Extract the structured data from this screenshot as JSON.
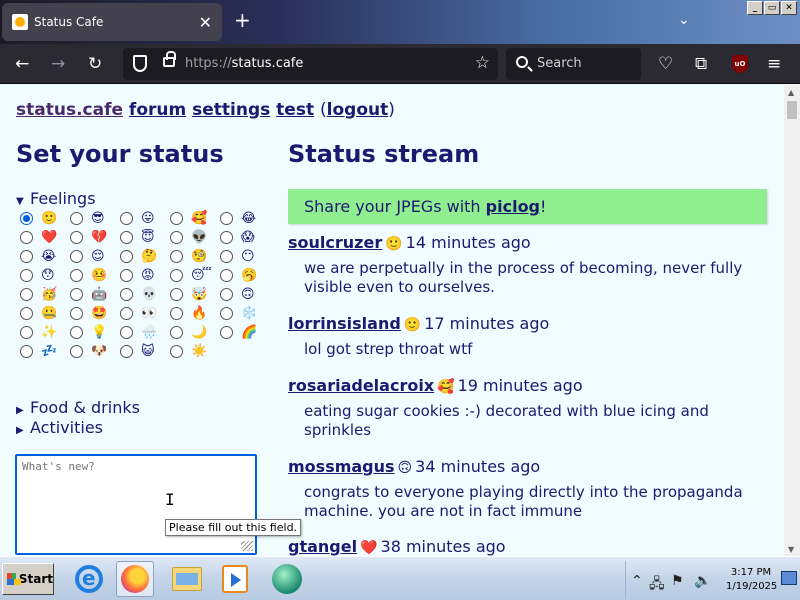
{
  "browser": {
    "tab_title": "Status Cafe",
    "new_tab": "+",
    "url_scheme": "https://",
    "url_host": "status.cafe",
    "search_placeholder": "Search",
    "window_buttons": [
      "_",
      "▭",
      "✕"
    ],
    "ublock_label": "uO"
  },
  "nav": {
    "brand": "status.cafe",
    "links": [
      "forum",
      "settings",
      "test"
    ],
    "logout": "logout"
  },
  "left": {
    "heading": "Set your status",
    "feelings_label": "Feelings",
    "emojis": [
      "🙂",
      "😎",
      "😛",
      "🥰",
      "😂",
      "❤️",
      "💔",
      "😇",
      "👽",
      "😱",
      "😭",
      "😌",
      "🤔",
      "🧐",
      "😶",
      "😯",
      "🤒",
      "😡",
      "😴",
      "🥱",
      "🥳",
      "🤖",
      "💀",
      "🤯",
      "🙃",
      "🤐",
      "🤩",
      "👀",
      "🔥",
      "❄️",
      "✨",
      "💡",
      "🌧️",
      "🌙",
      "🌈",
      "💤",
      "🐶",
      "😺",
      "☀️"
    ],
    "selected_index": 0,
    "food_label": "Food & drinks",
    "activities_label": "Activities",
    "input_placeholder": "What's new?",
    "tooltip": "Please fill out this field."
  },
  "stream": {
    "heading": "Status stream",
    "banner_prefix": "Share your JPEGs with ",
    "banner_link": "piclog",
    "banner_suffix": "!",
    "entries": [
      {
        "user": "soulcruzer",
        "face": "🙂",
        "time": "14 minutes ago",
        "text": "we are perpetually in the process of becoming, never fully visible even to ourselves."
      },
      {
        "user": "lorrinsisland",
        "face": "🙂",
        "time": "17 minutes ago",
        "text": "lol got strep throat wtf"
      },
      {
        "user": "rosariadelacroix",
        "face": "🥰",
        "time": "19 minutes ago",
        "text": "eating sugar cookies :-) decorated with blue icing and sprinkles"
      },
      {
        "user": "mossmagus",
        "face": "🙃",
        "time": "34 minutes ago",
        "text": "congrats to everyone playing directly into the propaganda machine. you are not in fact immune"
      },
      {
        "user": "gtangel",
        "face": "❤️",
        "time": "38 minutes ago",
        "text": ""
      }
    ]
  },
  "taskbar": {
    "start_label": "Start",
    "time": "3:17 PM",
    "date": "1/19/2025"
  },
  "colors": {
    "page_bg": "#f0fcff",
    "text": "#1a1a6e",
    "banner_bg": "#90ee90",
    "radio_accent": "#0060df"
  }
}
